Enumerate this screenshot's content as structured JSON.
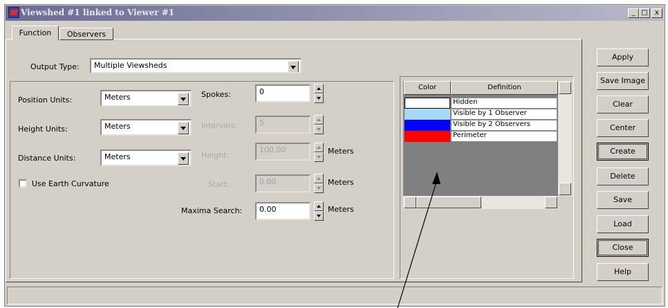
{
  "window": {
    "title": "Viewshed #1 linked to Viewer #1",
    "caption_buttons": [
      "_",
      "□",
      "x"
    ]
  },
  "tabs": [
    "Function",
    "Observers"
  ],
  "output_type": {
    "label": "Output Type:",
    "value": "Multiple Viewsheds"
  },
  "units": {
    "position": {
      "label": "Position Units:",
      "value": "Meters"
    },
    "height": {
      "label": "Height Units:",
      "value": "Meters"
    },
    "distance": {
      "label": "Distance Units:",
      "value": "Meters"
    },
    "earth_curvature": "Use Earth Curvature"
  },
  "params": {
    "spokes": {
      "label": "Spokes:",
      "value": "0"
    },
    "intervals": {
      "label": "Intervals:",
      "value": "5"
    },
    "height": {
      "label": "Height:",
      "value": "100.00",
      "unit": "Meters"
    },
    "start": {
      "label": "Start:",
      "value": "0.00",
      "unit": "Meters"
    },
    "maxima": {
      "label": "Maxima Search:",
      "value": "0.00",
      "unit": "Meters"
    }
  },
  "color_table": {
    "headers": [
      "Color",
      "Definition"
    ],
    "rows": [
      {
        "color": "#ffffff",
        "definition": "Hidden"
      },
      {
        "color": "#a6d8f7",
        "definition": "Visible by 1 Observer"
      },
      {
        "color": "#0000ff",
        "definition": "Visible by 2 Observers"
      },
      {
        "color": "#ff0000",
        "definition": "Perimeter"
      }
    ]
  },
  "buttons": [
    "Apply",
    "Save Image",
    "Clear",
    "Center",
    "Create",
    "Delete",
    "Save",
    "Load",
    "Close",
    "Help"
  ]
}
